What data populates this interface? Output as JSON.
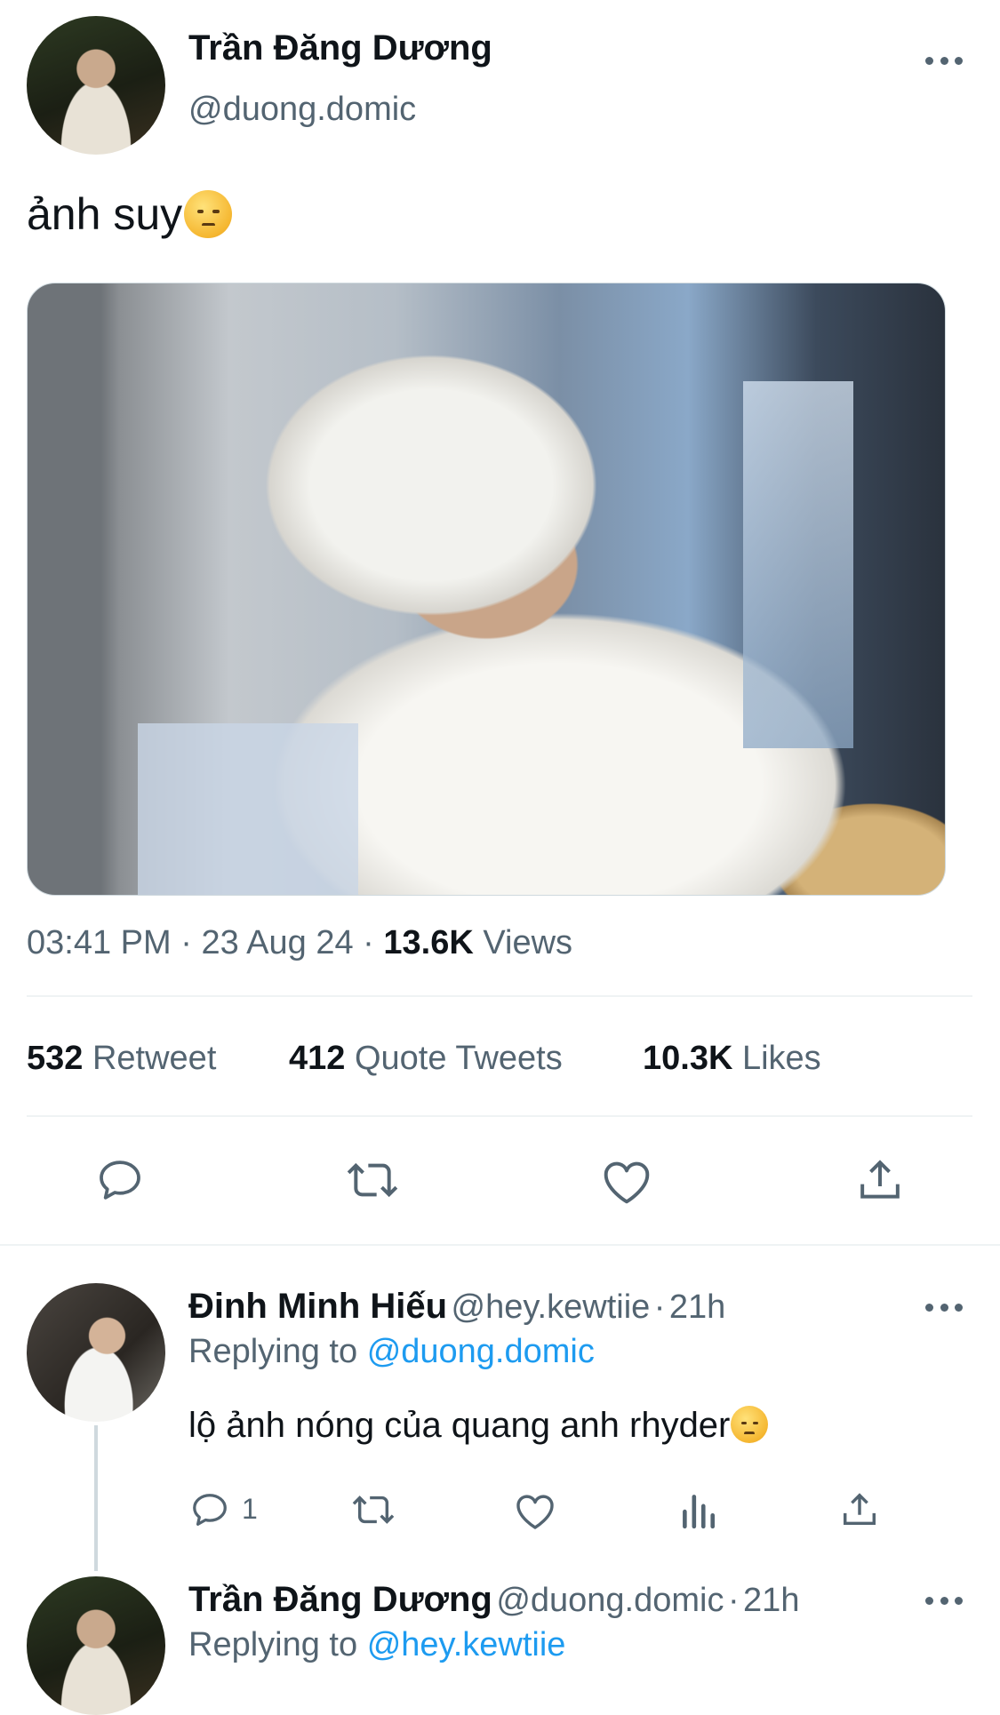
{
  "tweet": {
    "author_name": "Trần Đăng Dương",
    "author_handle": "@duong.domic",
    "text": "ảnh suy",
    "time": "03:41 PM",
    "date": "23 Aug 24",
    "views_count": "13.6K",
    "views_label": "Views",
    "separator": "·",
    "retweet_count": "532",
    "retweet_label": "Retweet",
    "quote_count": "412",
    "quote_label": "Quote Tweets",
    "likes_count": "10.3K",
    "likes_label": "Likes"
  },
  "replies": [
    {
      "author_name": "Đinh Minh Hiếu",
      "author_handle": "@hey.kewtiie",
      "age": "21h",
      "replying_label": "Replying to",
      "replying_to": "@duong.domic",
      "text": "lộ ảnh nóng của quang anh rhyder",
      "reply_count": "1"
    },
    {
      "author_name": "Trần Đăng Dương",
      "author_handle": "@duong.domic",
      "age": "21h",
      "replying_label": "Replying to",
      "replying_to": "@hey.kewtiie"
    }
  ],
  "icons": {
    "more": "more-horizontal-icon",
    "reply": "speech-bubble-icon",
    "retweet": "retweet-icon",
    "like": "heart-icon",
    "share": "share-upload-icon",
    "analytics": "bar-chart-icon"
  },
  "colors": {
    "accent": "#1d9bf0",
    "text_primary": "#0f1419",
    "text_secondary": "#536471",
    "divider": "#eff3f4"
  }
}
